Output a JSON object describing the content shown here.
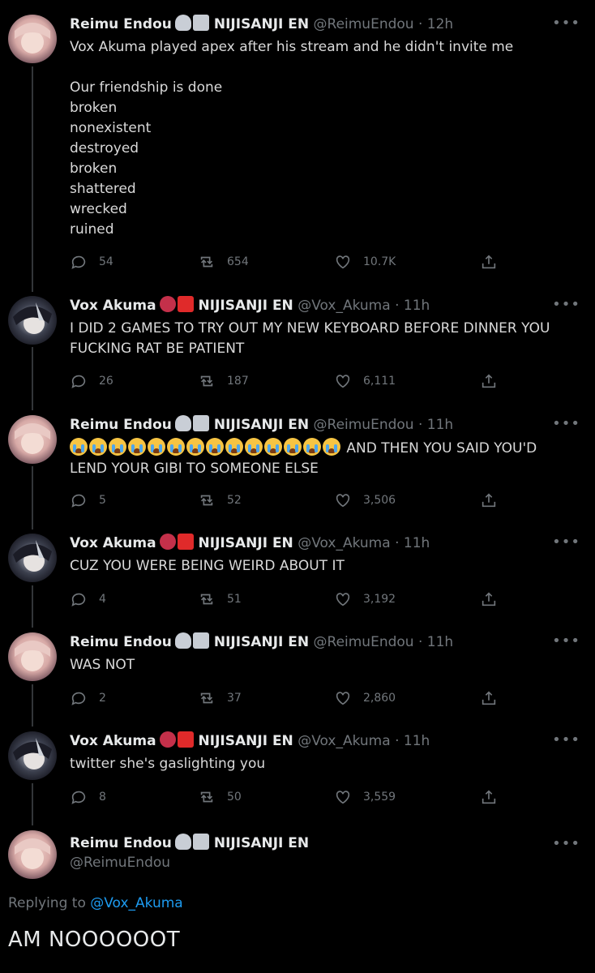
{
  "colors": {
    "background": "#000000",
    "text": "#d9d9d9",
    "muted": "#71767b",
    "link": "#1d9bf0"
  },
  "tweets": [
    {
      "name": "Reimu Endou",
      "org": "NIJISANJI EN",
      "handle": "@ReimuEndou",
      "dot": "·",
      "time": "12h",
      "lines": [
        "Vox Akuma played apex after his stream and he didn't invite me",
        "",
        "Our friendship is done",
        "broken",
        "nonexistent",
        "destroyed",
        "broken",
        "shattered",
        "wrecked",
        "ruined"
      ],
      "replies": "54",
      "retweets": "654",
      "likes": "10.7K"
    },
    {
      "name": "Vox Akuma",
      "org": "NIJISANJI EN",
      "handle": "@Vox_Akuma",
      "dot": "·",
      "time": "11h",
      "lines": [
        "I DID 2 GAMES TO TRY OUT MY NEW KEYBOARD BEFORE DINNER YOU",
        "FUCKING RAT BE PATIENT"
      ],
      "replies": "26",
      "retweets": "187",
      "likes": "6,111"
    },
    {
      "name": "Reimu Endou",
      "org": "NIJISANJI EN",
      "handle": "@ReimuEndou",
      "dot": "·",
      "time": "11h",
      "emoji_line_text": "AND THEN YOU SAID YOU'D",
      "lines": [
        "LEND YOUR GIBI TO SOMEONE ELSE"
      ],
      "replies": "5",
      "retweets": "52",
      "likes": "3,506"
    },
    {
      "name": "Vox Akuma",
      "org": "NIJISANJI EN",
      "handle": "@Vox_Akuma",
      "dot": "·",
      "time": "11h",
      "lines": [
        "CUZ YOU WERE BEING WEIRD ABOUT IT"
      ],
      "replies": "4",
      "retweets": "51",
      "likes": "3,192"
    },
    {
      "name": "Reimu Endou",
      "org": "NIJISANJI EN",
      "handle": "@ReimuEndou",
      "dot": "·",
      "time": "11h",
      "lines": [
        "WAS NOT"
      ],
      "replies": "2",
      "retweets": "37",
      "likes": "2,860"
    },
    {
      "name": "Vox Akuma",
      "org": "NIJISANJI EN",
      "handle": "@Vox_Akuma",
      "dot": "·",
      "time": "11h",
      "lines": [
        "twitter she's gaslighting you"
      ],
      "replies": "8",
      "retweets": "50",
      "likes": "3,559"
    }
  ],
  "main_tweet": {
    "name": "Reimu Endou",
    "org": "NIJISANJI EN",
    "handle": "@ReimuEndou",
    "replying_prefix": "Replying to",
    "replying_handle": "@Vox_Akuma",
    "text": "AM NOOOOOOT"
  },
  "icons": {
    "reply": "reply-icon",
    "retweet": "retweet-icon",
    "like": "heart-icon",
    "share": "share-icon",
    "more": "more-icon",
    "reimu_emoji": "ghost-book-icon",
    "vox_emoji": "demon-envelope-icon",
    "crying_emoji": "loudly-crying-face-icon"
  }
}
